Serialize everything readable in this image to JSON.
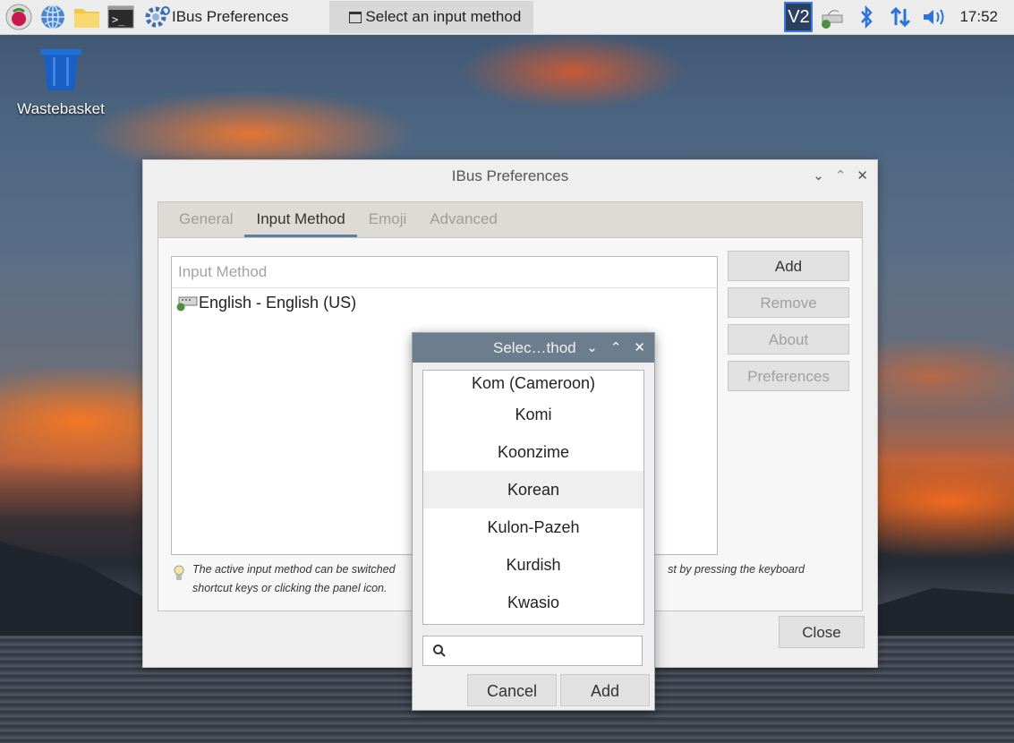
{
  "taskbar": {
    "tasks": [
      {
        "label": "IBus Preferences"
      },
      {
        "label": "Select an input method"
      }
    ],
    "clock": "17:52"
  },
  "desktop": {
    "wastebasket_label": "Wastebasket"
  },
  "ibus_window": {
    "title": "IBus Preferences",
    "tabs": [
      {
        "label": "General"
      },
      {
        "label": "Input Method"
      },
      {
        "label": "Emoji"
      },
      {
        "label": "Advanced"
      }
    ],
    "active_tab": "Input Method",
    "list_header": "Input Method",
    "input_methods": [
      {
        "label": "English - English (US)"
      }
    ],
    "buttons": {
      "add": "Add",
      "remove": "Remove",
      "about": "About",
      "preferences": "Preferences",
      "close": "Close"
    },
    "hint_line1_left": "The active input method can be switched",
    "hint_line1_right": "st by pressing the keyboard",
    "hint_line2": "shortcut keys or clicking the panel icon."
  },
  "select_dialog": {
    "title": "Selec…thod",
    "languages": [
      {
        "label": "Kom (Cameroon)"
      },
      {
        "label": "Komi"
      },
      {
        "label": "Koonzime"
      },
      {
        "label": "Korean"
      },
      {
        "label": "Kulon-Pazeh"
      },
      {
        "label": "Kurdish"
      },
      {
        "label": "Kwasio"
      }
    ],
    "selected": "Korean",
    "search_value": "",
    "cancel_label": "Cancel",
    "add_label": "Add"
  },
  "colors": {
    "dialog_titlebar": "#6c7d8d",
    "tab_underline": "#5d7da3",
    "taskbar_bg": "#ececec"
  }
}
